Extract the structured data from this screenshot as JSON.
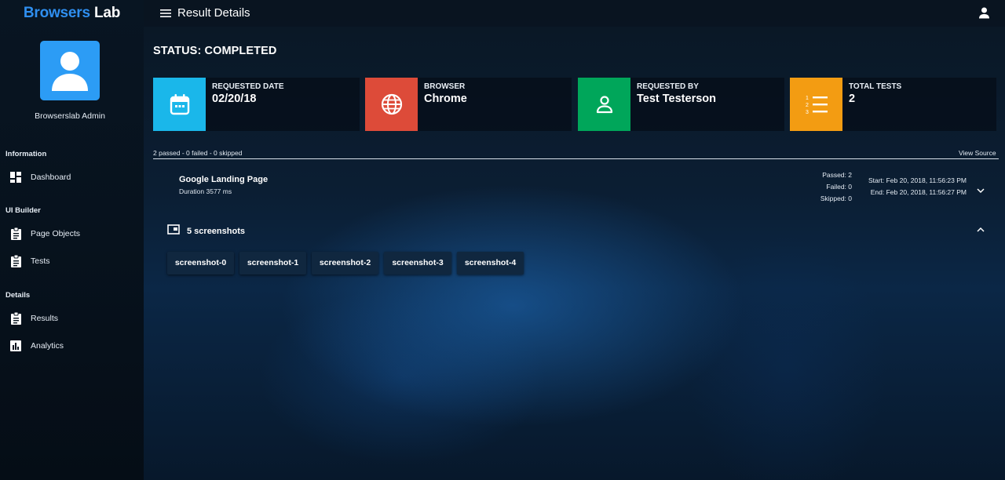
{
  "brand": {
    "part1": "Browsers",
    "part2": "Lab"
  },
  "user": {
    "name": "Browserslab Admin"
  },
  "nav": {
    "sections": [
      {
        "title": "Information",
        "items": [
          {
            "label": "Dashboard",
            "icon": "dashboard-icon"
          }
        ]
      },
      {
        "title": "UI Builder",
        "items": [
          {
            "label": "Page Objects",
            "icon": "clipboard-icon"
          },
          {
            "label": "Tests",
            "icon": "clipboard-icon"
          }
        ]
      },
      {
        "title": "Details",
        "items": [
          {
            "label": "Results",
            "icon": "clipboard-icon"
          },
          {
            "label": "Analytics",
            "icon": "bar-chart-icon"
          }
        ]
      }
    ]
  },
  "header": {
    "title": "Result Details"
  },
  "status": "STATUS: COMPLETED",
  "cards": [
    {
      "label": "REQUESTED DATE",
      "value": "02/20/18",
      "color": "#1ab7ea",
      "icon": "calendar-icon"
    },
    {
      "label": "BROWSER",
      "value": "Chrome",
      "color": "#dd4b39",
      "icon": "globe-icon"
    },
    {
      "label": "REQUESTED BY",
      "value": "Test Testerson",
      "color": "#00a65a",
      "icon": "person-icon"
    },
    {
      "label": "TOTAL TESTS",
      "value": "2",
      "color": "#f39c12",
      "icon": "numbered-list-icon"
    }
  ],
  "summary": "2 passed - 0 failed - 0 skipped",
  "view_source": "View Source",
  "test": {
    "title": "Google Landing Page",
    "duration": "Duration 3577 ms",
    "passed": "Passed: 2",
    "failed": "Failed: 0",
    "skipped": "Skipped: 0",
    "start": "Start: Feb 20, 2018, 11:56:23 PM",
    "end": "End: Feb 20, 2018, 11:56:27 PM"
  },
  "screenshots": {
    "label": "5 screenshots",
    "items": [
      "screenshot-0",
      "screenshot-1",
      "screenshot-2",
      "screenshot-3",
      "screenshot-4"
    ]
  }
}
